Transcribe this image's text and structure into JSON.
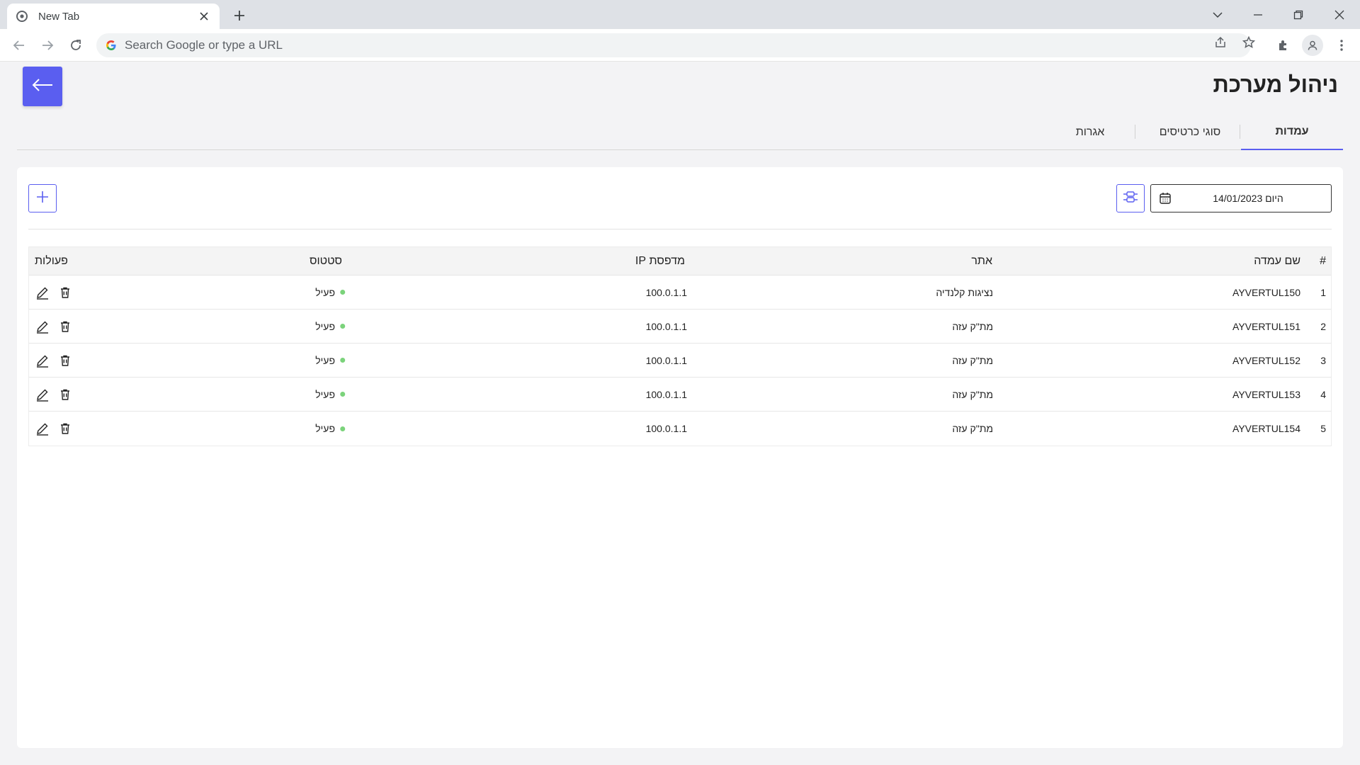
{
  "browser": {
    "tab_title": "New Tab",
    "omnibox_placeholder": "Search Google or type a URL"
  },
  "app": {
    "title": "ניהול מערכת",
    "tabs": [
      {
        "label": "עמדות",
        "active": true
      },
      {
        "label": "סוגי כרטיסים",
        "active": false
      },
      {
        "label": "אגרות",
        "active": false
      }
    ],
    "date_value": "14/01/2023 היום",
    "accent": "#5a5ef0",
    "status_color": "#7bd37b"
  },
  "table": {
    "headers": {
      "index": "#",
      "station_name": "שם עמדה",
      "site": "אתר",
      "printer_ip": "מדפסת IP",
      "status": "סטטוס",
      "actions": "פעולות"
    },
    "rows": [
      {
        "index": "1",
        "station_name": "AYVERTUL150",
        "site": "נציגות קלנדיה",
        "printer_ip": "100.0.1.1",
        "status": "פעיל"
      },
      {
        "index": "2",
        "station_name": "AYVERTUL151",
        "site": "מת\"ק עזה",
        "printer_ip": "100.0.1.1",
        "status": "פעיל"
      },
      {
        "index": "3",
        "station_name": "AYVERTUL152",
        "site": "מת\"ק עזה",
        "printer_ip": "100.0.1.1",
        "status": "פעיל"
      },
      {
        "index": "4",
        "station_name": "AYVERTUL153",
        "site": "מת\"ק עזה",
        "printer_ip": "100.0.1.1",
        "status": "פעיל"
      },
      {
        "index": "5",
        "station_name": "AYVERTUL154",
        "site": "מת\"ק עזה",
        "printer_ip": "100.0.1.1",
        "status": "פעיל"
      }
    ]
  }
}
